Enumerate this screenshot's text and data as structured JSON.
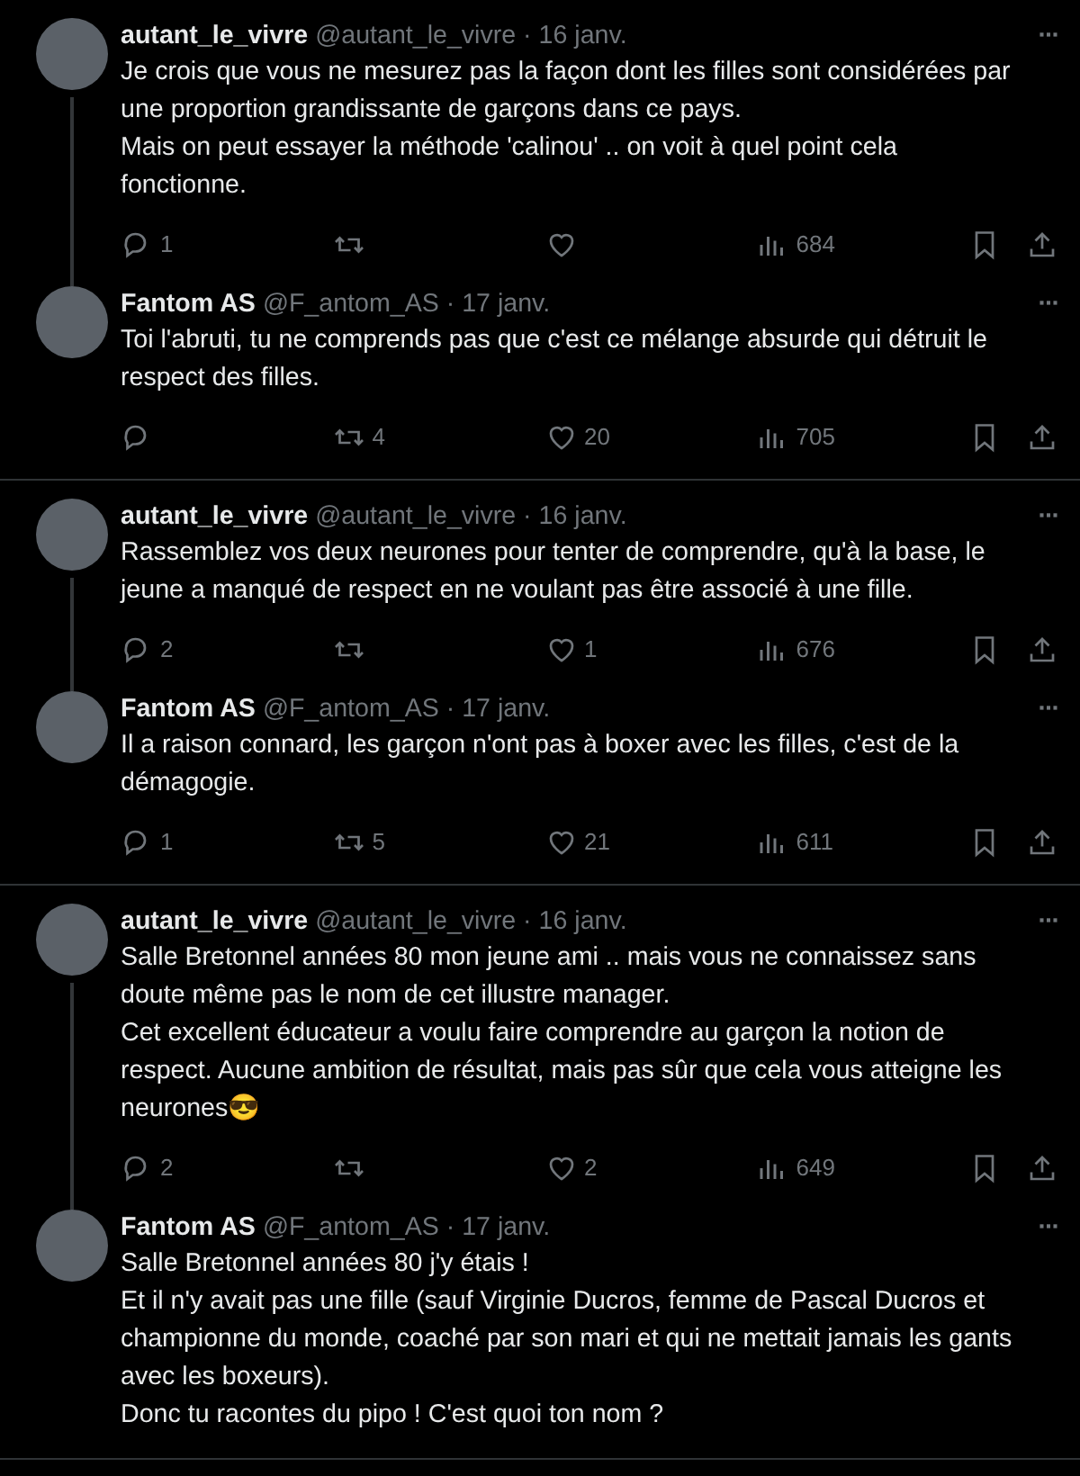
{
  "threads": [
    {
      "tweets": [
        {
          "name": "autant_le_vivre",
          "handle_and_date": "@autant_le_vivre · 16 janv.",
          "more": "···",
          "text": "Je crois que vous ne mesurez pas la façon dont les filles sont considérées par une proportion grandissante de garçons dans ce pays.\nMais on peut essayer la méthode 'calinou' .. on voit à quel point cela fonctionne.",
          "actions": [
            {
              "kind": "reply",
              "count": "1"
            },
            {
              "kind": "retweet"
            },
            {
              "kind": "like"
            },
            {
              "kind": "views",
              "count": "684"
            },
            {
              "kind": "bookmark"
            },
            {
              "kind": "share"
            }
          ]
        },
        {
          "name": "Fantom AS",
          "handle_and_date": "@F_antom_AS · 17 janv.",
          "more": "···",
          "text": "Toi l'abruti, tu ne comprends pas que c'est ce mélange absurde qui détruit le respect des filles.",
          "actions": [
            {
              "kind": "reply"
            },
            {
              "kind": "retweet",
              "count": "4"
            },
            {
              "kind": "like",
              "count": "20"
            },
            {
              "kind": "views",
              "count": "705"
            },
            {
              "kind": "bookmark"
            },
            {
              "kind": "share"
            }
          ]
        }
      ]
    },
    {
      "tweets": [
        {
          "name": "autant_le_vivre",
          "handle_and_date": "@autant_le_vivre · 16 janv.",
          "more": "···",
          "text": "Rassemblez vos deux neurones pour tenter de comprendre, qu'à la base, le jeune a manqué de respect en ne voulant pas être associé à une fille.",
          "actions": [
            {
              "kind": "reply",
              "count": "2"
            },
            {
              "kind": "retweet"
            },
            {
              "kind": "like",
              "count": "1"
            },
            {
              "kind": "views",
              "count": "676"
            },
            {
              "kind": "bookmark"
            },
            {
              "kind": "share"
            }
          ]
        },
        {
          "name": "Fantom AS",
          "handle_and_date": "@F_antom_AS · 17 janv.",
          "more": "···",
          "text": "Il a raison connard, les garçon n'ont pas à boxer avec les filles, c'est de la démagogie.",
          "actions": [
            {
              "kind": "reply",
              "count": "1"
            },
            {
              "kind": "retweet",
              "count": "5"
            },
            {
              "kind": "like",
              "count": "21"
            },
            {
              "kind": "views",
              "count": "611"
            },
            {
              "kind": "bookmark"
            },
            {
              "kind": "share"
            }
          ]
        }
      ]
    },
    {
      "tweets": [
        {
          "name": "autant_le_vivre",
          "handle_and_date": "@autant_le_vivre · 16 janv.",
          "more": "···",
          "text": "Salle Bretonnel années 80 mon jeune ami .. mais vous ne connaissez sans doute même pas le nom de cet illustre manager.\nCet excellent éducateur a voulu faire comprendre au garçon la notion de respect. Aucune ambition de résultat, mais pas sûr que cela vous atteigne les neurones😎",
          "actions": [
            {
              "kind": "reply",
              "count": "2"
            },
            {
              "kind": "retweet"
            },
            {
              "kind": "like",
              "count": "2"
            },
            {
              "kind": "views",
              "count": "649"
            },
            {
              "kind": "bookmark"
            },
            {
              "kind": "share"
            }
          ]
        },
        {
          "name": "Fantom AS",
          "handle_and_date": "@F_antom_AS · 17 janv.",
          "more": "···",
          "text": "Salle Bretonnel années 80 j'y étais !\nEt il n'y avait pas une fille (sauf Virginie Ducros, femme de Pascal Ducros et championne du monde, coaché par son mari et qui ne mettait jamais les gants avec les boxeurs).\nDonc tu racontes du pipo ! C'est quoi ton nom ?"
        }
      ]
    }
  ]
}
